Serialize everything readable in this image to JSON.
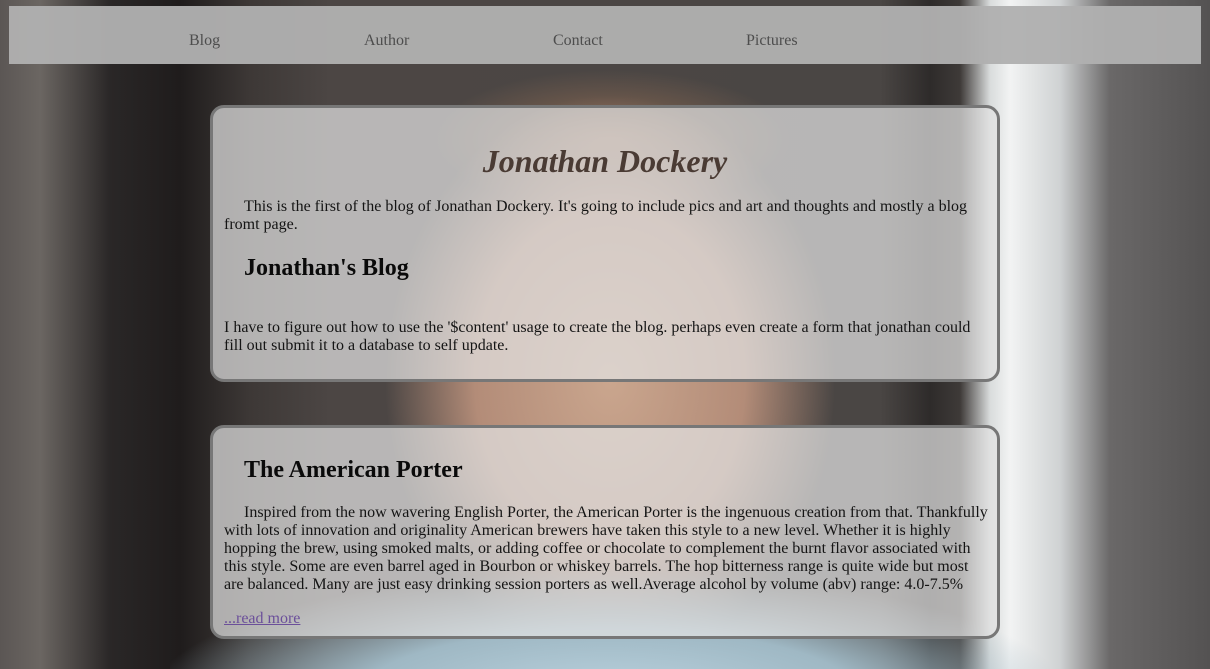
{
  "nav": {
    "items": [
      {
        "label": "Blog"
      },
      {
        "label": "Author"
      },
      {
        "label": "Contact"
      },
      {
        "label": "Pictures"
      }
    ]
  },
  "intro": {
    "title": "Jonathan Dockery",
    "description": "This is the first of the blog of Jonathan Dockery. It's going to include pics and art and thoughts and mostly a blog fromt page.",
    "blog_heading": "Jonathan's Blog",
    "blog_text": "I have to figure out how to use the '$content' usage to create the blog. perhaps even create a form that jonathan could fill out submit it to a database to self update."
  },
  "post": {
    "heading": "The American Porter",
    "body": "Inspired from the now wavering English Porter, the American Porter is the ingenuous creation from that. Thankfully with lots of innovation and originality American brewers have taken this style to a new level. Whether it is highly hopping the brew, using smoked malts, or adding coffee or chocolate to complement the burnt flavor associated with this style. Some are even barrel aged in Bourbon or whiskey barrels. The hop bitterness range is quite wide but most are balanced. Many are just easy drinking session porters as well.Average alcohol by volume (abv) range: 4.0-7.5%",
    "read_more": "...read more"
  },
  "colors": {
    "nav_bg": "#b0b0b0",
    "title": "#4a3b34",
    "link": "#6b4f9a"
  }
}
